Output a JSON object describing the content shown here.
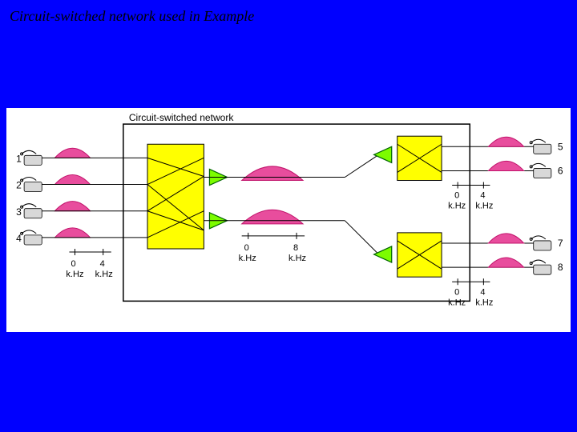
{
  "title": "Circuit-switched network used in Example",
  "box_label": "Circuit-switched network",
  "phones": {
    "left": [
      "1",
      "2",
      "3",
      "4"
    ],
    "right": [
      "5",
      "6",
      "7",
      "8"
    ]
  },
  "bw_left": {
    "low": "0",
    "high": "4",
    "unit": "k.Hz"
  },
  "bw_mid": {
    "low": "0",
    "high": "8",
    "unit": "k.Hz"
  },
  "bw_right_top": {
    "low": "0",
    "high": "4",
    "unit": "k.Hz"
  },
  "bw_right_bot": {
    "low": "0",
    "high": "4",
    "unit": "k.Hz"
  },
  "colors": {
    "bg": "#0000ff",
    "switch": "#ffff00",
    "amp": "#7cfc00",
    "arc": "#e84d9d"
  }
}
